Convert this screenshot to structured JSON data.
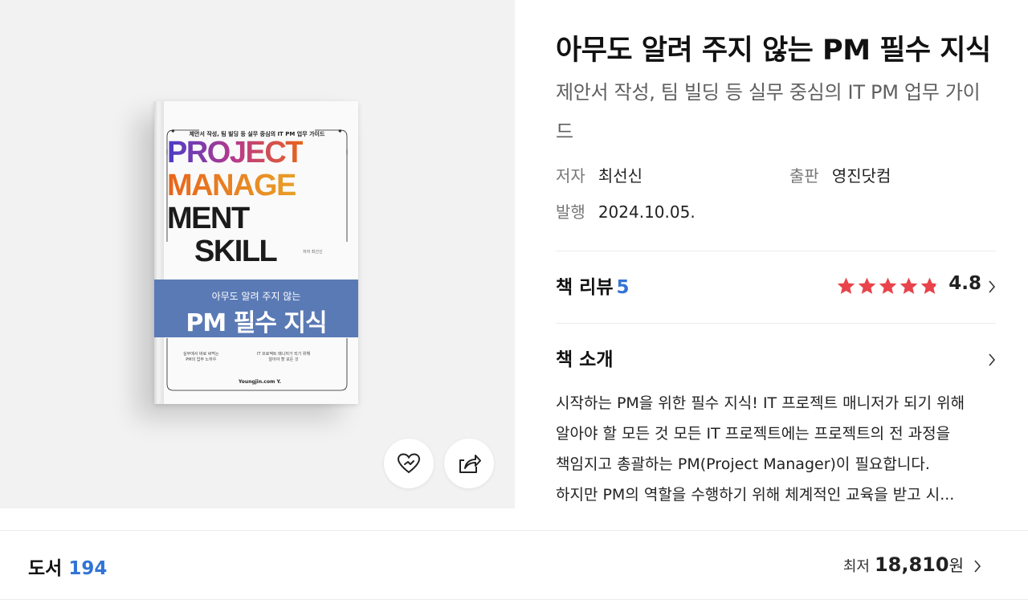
{
  "book": {
    "title_main": "아무도 알려 주지 않는 PM 필수 지식",
    "title_sub": "제안서 작성, 팀 빌딩 등 실무 중심의 IT PM 업무 가이드",
    "author_label": "저자",
    "author": "최선신",
    "publisher_label": "출판",
    "publisher": "영진닷컴",
    "date_label": "발행",
    "date": "2024.10.05."
  },
  "cover": {
    "subtitle": "제안서 작성, 팀 빌딩 등 실무 중심의 IT PM 업무 가이드",
    "title_lines": [
      "PROJECT",
      "MANAGE",
      "MENT",
      "SKILL"
    ],
    "author_small": "저자 최선신",
    "band_small": "아무도 알려 주지 않는",
    "band_big": "PM 필수 지식",
    "bottom_left": "실무에서 바로 써먹는\nPM의 업무 노하우",
    "bottom_right": "IT 프로젝트 매니저가 되기 위해\n알아야 할 모든 것",
    "publisher_logo": "Youngjin.com Y."
  },
  "actions": {
    "like_icon": "heart-icon",
    "share_icon": "share-icon"
  },
  "review": {
    "label": "책 리뷰",
    "count": "5",
    "rating": "4.8",
    "rating_value": 4.8
  },
  "intro": {
    "label": "책 소개",
    "text": "시작하는 PM을 위한 필수 지식! IT 프로젝트 매니저가 되기 위해 알아야 할 모든 것 모든 IT 프로젝트에는 프로젝트의 전 과정을 책임지고 총괄하는 PM(Project Manager)이 필요합니다.",
    "last_line": "하지만 PM의 역할을 수행하기 위해 체계적인 교육을 받고 시..."
  },
  "bottom": {
    "books_label": "도서",
    "books_count": "194",
    "price_label": "최저",
    "price": "18,810",
    "price_unit": "원"
  },
  "colors": {
    "accent_blue": "#3274d6",
    "star_red": "#e9434b",
    "cover_band": "#5a7ab5"
  }
}
